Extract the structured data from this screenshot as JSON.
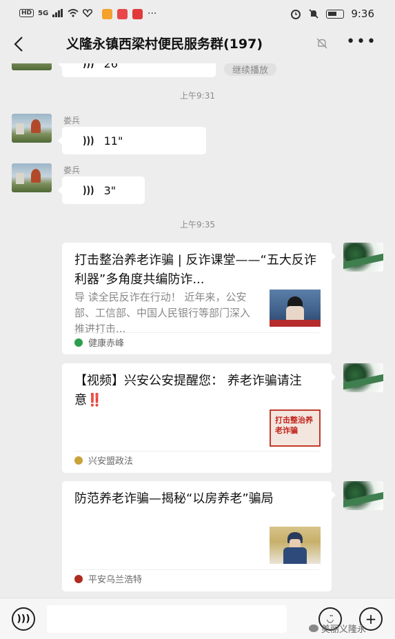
{
  "status_bar": {
    "left_signal": "5G",
    "hd": "HD",
    "time": "9:36"
  },
  "header": {
    "back_icon": "chevron-left-icon",
    "title": "义隆永镇西梁村便民服务群(197)",
    "mute_icon": "bell-off-icon",
    "more_label": "•••"
  },
  "messages": {
    "top_voice": {
      "duration": "26\"",
      "action": "继续播放"
    },
    "time_1": "上午9:31",
    "voice_1": {
      "sender": "娄兵",
      "duration": "11\""
    },
    "voice_2": {
      "sender": "娄兵",
      "duration": "3\""
    },
    "time_2": "上午9:35",
    "card_1": {
      "title": "打击整治养老诈骗 | 反诈课堂——“五大反诈利器”多角度共编防诈...",
      "desc": "导 读全民反诈在行动！ 近年来，公安部、工信部、中国人民银行等部门深入推进打击...",
      "source": "健康赤峰",
      "source_color": "#2e9d4e"
    },
    "card_2": {
      "title": "【视频】兴安公安提醒您： 养老诈骗请注意‼️",
      "thumb_text": "打击整治养老诈骗",
      "source": "兴安盟政法",
      "source_color": "#c9a23a"
    },
    "card_3": {
      "title": "防范养老诈骗—揭秘“以房养老”骗局",
      "source": "平安乌兰浩特",
      "source_color": "#b02a1e"
    }
  },
  "bottom_bar": {
    "voice_icon": "voice-icon",
    "emoji_icon": "emoji-icon",
    "watermark": "美丽义隆永"
  }
}
